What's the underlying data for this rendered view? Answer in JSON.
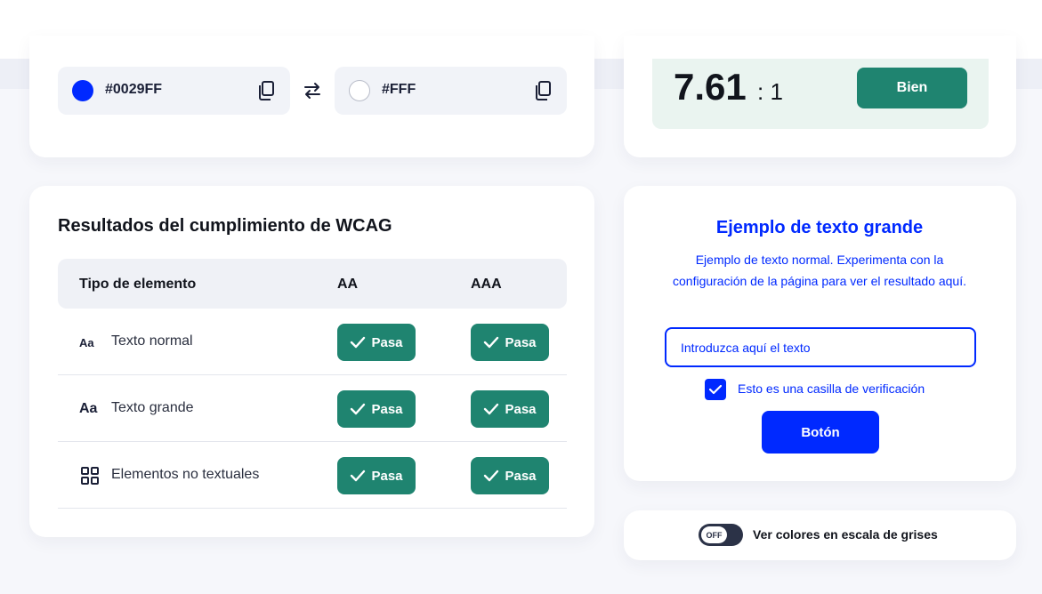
{
  "colors": {
    "foreground": {
      "hex": "#0029FF",
      "swatch": "#0029ff"
    },
    "background": {
      "hex": "#FFF",
      "swatch": "#ffffff"
    },
    "accent_green": "#1f8470",
    "accent_blue": "#0029ff"
  },
  "icons": {
    "copy": "copy-icon",
    "swap": "swap-arrows-icon",
    "check": "check-icon",
    "grid": "grid-icon"
  },
  "ratio": {
    "value": "7.61",
    "suffix": ": 1",
    "rating": "Bien"
  },
  "wcag": {
    "title": "Resultados del cumplimiento de WCAG",
    "columns": [
      "Tipo de elemento",
      "AA",
      "AAA"
    ],
    "rows": [
      {
        "icon_text": "Aa",
        "label": "Texto normal",
        "aa": "Pasa",
        "aaa": "Pasa"
      },
      {
        "icon_text": "Aa",
        "label": "Texto grande",
        "aa": "Pasa",
        "aaa": "Pasa"
      },
      {
        "icon_text": "",
        "label": "Elementos no textuales",
        "aa": "Pasa",
        "aaa": "Pasa"
      }
    ]
  },
  "example": {
    "title": "Ejemplo de texto grande",
    "body": "Ejemplo de texto normal. Experimenta con la configuración de la página para ver el resultado aquí.",
    "input_placeholder": "Introduzca aquí el texto",
    "checkbox_label": "Esto es una casilla de verificación",
    "checkbox_checked": true,
    "button_label": "Botón"
  },
  "grayscale": {
    "toggle_state": "OFF",
    "label": "Ver colores en escala de grises"
  }
}
